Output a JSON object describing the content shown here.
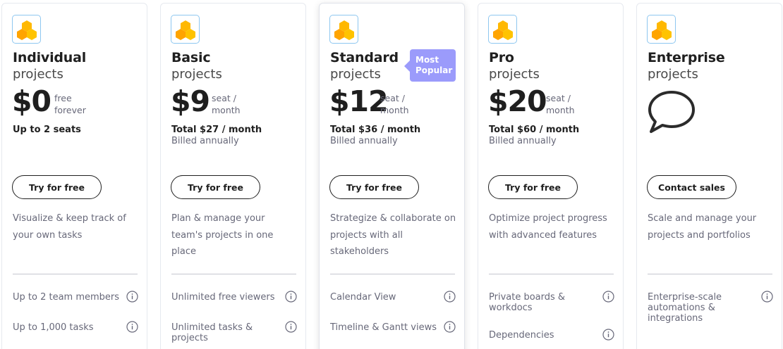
{
  "colors": {
    "brand_orange": "#ffb800",
    "badge": "#9b9bfb",
    "text_dark": "#1f1f1f",
    "text_muted": "#676879"
  },
  "plans": [
    {
      "name": "Individual",
      "subtitle": "projects",
      "price": "$0",
      "per": [
        "free",
        "forever"
      ],
      "total": "Up to 2 seats",
      "billed": "",
      "cta": "Try for free",
      "description": "Visualize & keep track of your own tasks",
      "features": [
        "Up to 2 team members",
        "Up to 1,000 tasks"
      ]
    },
    {
      "name": "Basic",
      "subtitle": "projects",
      "price": "$9",
      "per": [
        "seat /",
        "month"
      ],
      "total": "Total $27 / month",
      "billed": "Billed annually",
      "cta": "Try for free",
      "description": "Plan & manage your team's projects in one place",
      "features": [
        "Unlimited free viewers",
        "Unlimited tasks & projects"
      ]
    },
    {
      "name": "Standard",
      "subtitle": "projects",
      "price": "$12",
      "per": [
        "seat /",
        "month"
      ],
      "total": "Total $36 / month",
      "billed": "Billed annually",
      "cta": "Try for free",
      "badge": "Most Popular",
      "description": "Strategize & collaborate on projects with all stakeholders",
      "features": [
        "Calendar View",
        "Timeline & Gantt views"
      ]
    },
    {
      "name": "Pro",
      "subtitle": "projects",
      "price": "$20",
      "per": [
        "seat /",
        "month"
      ],
      "total": "Total $60 / month",
      "billed": "Billed annually",
      "cta": "Try for free",
      "description": "Optimize project progress with advanced features",
      "features": [
        "Private boards & workdocs",
        "Dependencies"
      ]
    },
    {
      "name": "Enterprise",
      "subtitle": "projects",
      "price": "",
      "per": [],
      "total": "",
      "billed": "",
      "cta": "Contact sales",
      "icon": "speech-bubble-icon",
      "description": "Scale and manage your projects and portfolios",
      "features": [
        "Enterprise-scale automations & integrations"
      ]
    }
  ]
}
